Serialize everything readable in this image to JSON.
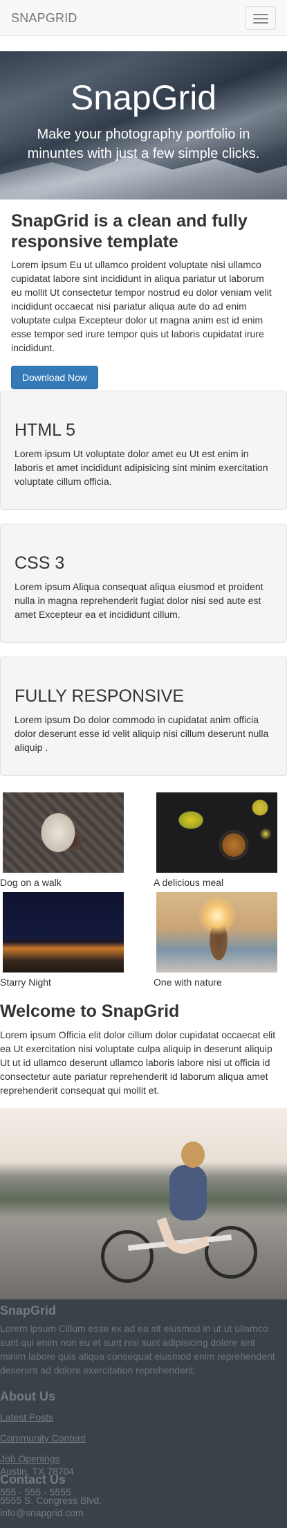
{
  "navbar": {
    "brand": "SNAPGRID",
    "toggle_icon": "hamburger-menu-icon"
  },
  "hero": {
    "title": "SnapGrid",
    "subtitle": "Make your photography portfolio in minuntes with just a few simple clicks."
  },
  "intro": {
    "title": "SnapGrid is a clean and fully responsive template",
    "text": "Lorem ipsum Eu ut ullamco proident voluptate nisi ullamco cupidatat labore sint incididunt in aliqua pariatur ut laborum eu mollit Ut consectetur tempor nostrud eu dolor veniam velit incididunt occaecat nisi pariatur aliqua aute do ad enim voluptate culpa Excepteur dolor ut magna anim est id enim esse tempor sed irure tempor quis ut laboris cupidatat irure incididunt.",
    "button_label": "Download Now",
    "button_color": "#337ab7"
  },
  "features": [
    {
      "title": "HTML 5",
      "text": "Lorem ipsum Ut voluptate dolor amet eu Ut est enim in laboris et amet incididunt adipisicing sint minim exercitation voluptate cillum officia."
    },
    {
      "title": "CSS 3",
      "text": "Lorem ipsum Aliqua consequat aliqua eiusmod et proident nulla in magna reprehenderit fugiat dolor nisi sed aute est amet Excepteur ea et incididunt cillum."
    },
    {
      "title": "FULLY RESPONSIVE",
      "text": "Lorem ipsum Do dolor commodo in cupidatat anim officia dolor deserunt esse id velit aliquip nisi cillum deserunt nulla aliquip ."
    }
  ],
  "gallery": [
    {
      "caption": "Dog on a walk"
    },
    {
      "caption": "A delicious meal"
    },
    {
      "caption": "Starry Night"
    },
    {
      "caption": "One with nature"
    }
  ],
  "welcome": {
    "title": "Welcome to SnapGrid",
    "text": "Lorem ipsum Officia elit dolor cillum dolor cupidatat occaecat elit ea Ut exercitation nisi voluptate culpa aliquip in deserunt aliquip Ut ut id ullamco deserunt ullamco laboris labore nisi ut officia id consectetur aute pariatur reprehenderit id laborum aliqua amet reprehenderit consequat qui mollit et."
  },
  "footer": {
    "brand": "SnapGrid",
    "text": "Lorem ipsum Cillum esse ex ad ea sit eiusmod in ut ut ullamco sunt qui enim non eu et sunt nisi sunt adipisicing dolore sint minim labore quis aliqua consequat eiusmod enim reprehenderit deserunt ad dolore exercitation reprehenderit.",
    "about_title": "About Us",
    "links": [
      "Latest Posts",
      "Community Content",
      "Job Openings"
    ],
    "contact_title": "Contact Us",
    "address_line1": "5555 S. Congress Blvd.",
    "address_line2": "Austin, TX 78704",
    "phone": "555 - 555 - 5555",
    "email": "info@snapgrid.com",
    "background": "#3b4148"
  }
}
